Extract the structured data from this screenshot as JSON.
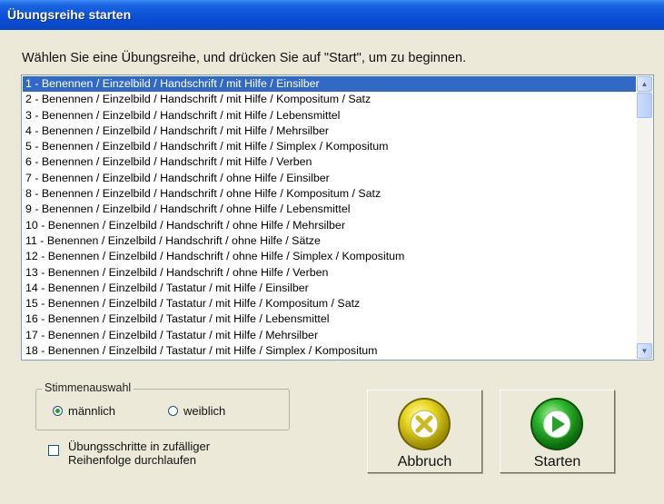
{
  "window": {
    "title": "Übungsreihe starten"
  },
  "prompt": "Wählen Sie eine Übungsreihe, und drücken Sie auf \"Start\", um zu beginnen.",
  "list": {
    "selected_index": 0,
    "items": [
      "1 - Benennen / Einzelbild / Handschrift / mit Hilfe / Einsilber",
      "2 - Benennen / Einzelbild / Handschrift / mit Hilfe / Kompositum / Satz",
      "3 - Benennen / Einzelbild / Handschrift / mit Hilfe / Lebensmittel",
      "4 - Benennen / Einzelbild / Handschrift / mit Hilfe / Mehrsilber",
      "5 - Benennen / Einzelbild / Handschrift / mit Hilfe / Simplex / Kompositum",
      "6 - Benennen / Einzelbild / Handschrift / mit Hilfe / Verben",
      "7 - Benennen / Einzelbild / Handschrift / ohne Hilfe / Einsilber",
      "8 - Benennen / Einzelbild / Handschrift / ohne Hilfe / Kompositum / Satz",
      "9 - Benennen / Einzelbild / Handschrift / ohne Hilfe / Lebensmittel",
      "10 - Benennen / Einzelbild / Handschrift / ohne Hilfe / Mehrsilber",
      "11 - Benennen / Einzelbild / Handschrift / ohne Hilfe / Sätze",
      "12 - Benennen / Einzelbild / Handschrift / ohne Hilfe / Simplex / Kompositum",
      "13 - Benennen / Einzelbild / Handschrift / ohne Hilfe / Verben",
      "14 - Benennen / Einzelbild / Tastatur / mit Hilfe / Einsilber",
      "15 - Benennen / Einzelbild / Tastatur / mit Hilfe / Kompositum / Satz",
      "16 - Benennen / Einzelbild / Tastatur / mit Hilfe / Lebensmittel",
      "17 - Benennen / Einzelbild / Tastatur / mit Hilfe / Mehrsilber",
      "18 - Benennen / Einzelbild / Tastatur / mit Hilfe / Simplex / Kompositum"
    ]
  },
  "voice": {
    "legend": "Stimmenauswahl",
    "options": [
      {
        "label": "männlich",
        "checked": true
      },
      {
        "label": "weiblich",
        "checked": false
      }
    ]
  },
  "random_order": {
    "label_line1": "Übungsschritte in zufälliger",
    "label_line2": "Reihenfolge durchlaufen",
    "checked": false
  },
  "buttons": {
    "cancel": {
      "label": "Abbruch",
      "icon": "x-icon",
      "color": "#e6d21a"
    },
    "start": {
      "label": "Starten",
      "icon": "play-icon",
      "color": "#23a623"
    }
  },
  "colors": {
    "titlebar": "#0a4fd6",
    "selection": "#316ac5",
    "dialog_bg": "#ece9d8"
  }
}
